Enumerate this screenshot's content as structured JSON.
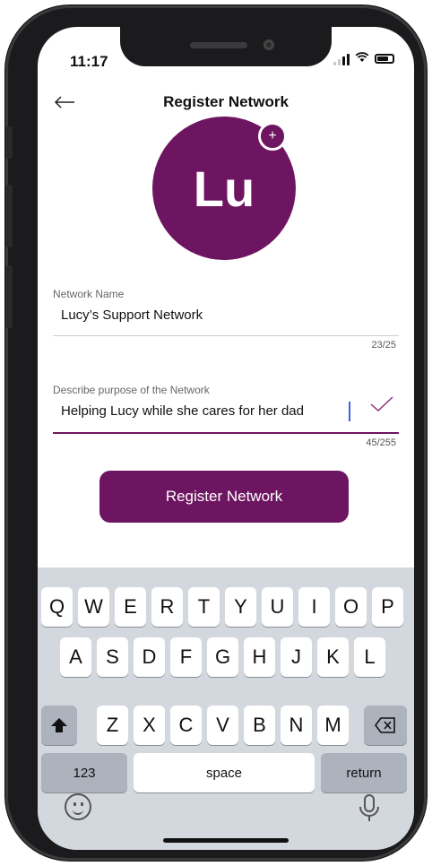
{
  "status": {
    "time": "11:17"
  },
  "header": {
    "title": "Register Network",
    "back_icon": "arrow-left-icon"
  },
  "avatar": {
    "initials": "Lu",
    "badge_symbol": "+",
    "color": "#6e1561"
  },
  "form": {
    "name": {
      "label": "Network Name",
      "value": "Lucy’s Support Network",
      "counter": "23/25"
    },
    "purpose": {
      "label": "Describe purpose of the Network",
      "value": "Helping Lucy while she cares for her dad",
      "counter": "45/255",
      "check_icon": "checkmark-icon"
    }
  },
  "register_button": {
    "label": "Register Network"
  },
  "keyboard": {
    "row1": [
      "Q",
      "W",
      "E",
      "R",
      "T",
      "Y",
      "U",
      "I",
      "O",
      "P"
    ],
    "row2": [
      "A",
      "S",
      "D",
      "F",
      "G",
      "H",
      "J",
      "K",
      "L"
    ],
    "row3": [
      "Z",
      "X",
      "C",
      "V",
      "B",
      "N",
      "M"
    ],
    "numbers_label": "123",
    "space_label": "space",
    "return_label": "return",
    "shift_icon": "shift-icon",
    "delete_icon": "backspace-icon",
    "emoji_icon": "emoji-icon",
    "mic_icon": "microphone-icon"
  }
}
